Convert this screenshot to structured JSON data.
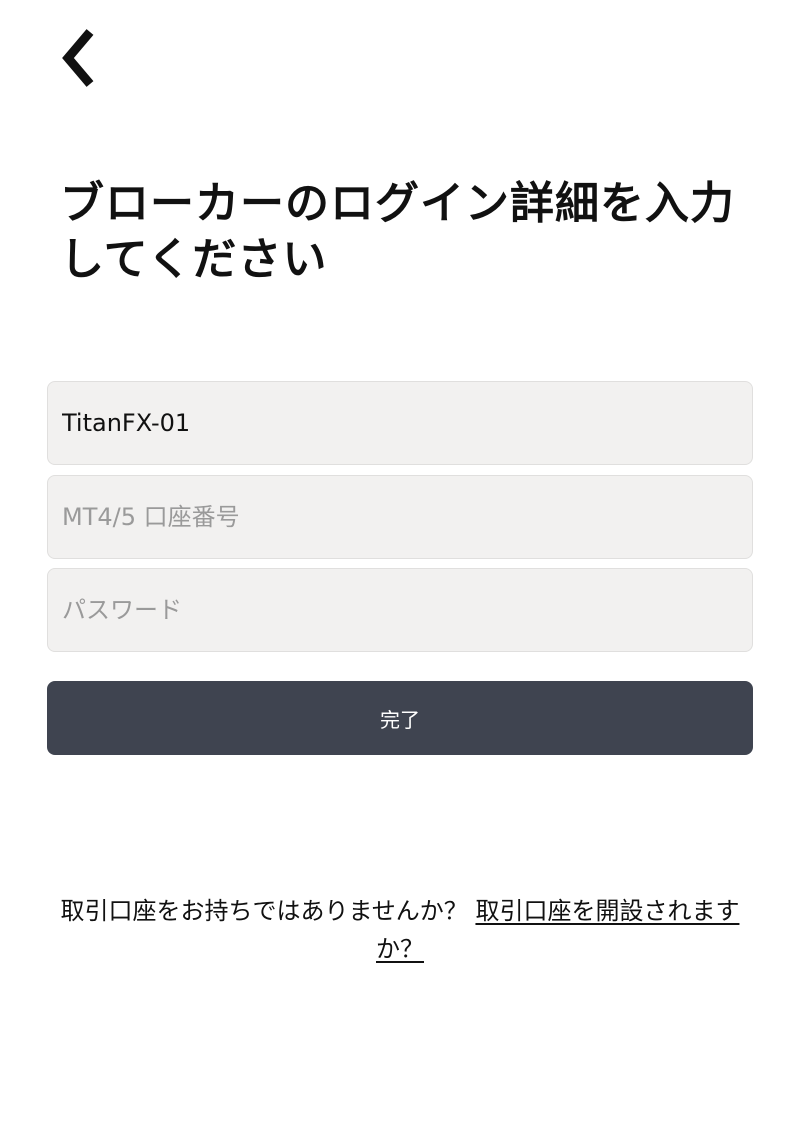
{
  "header": {
    "back_icon": "chevron-left-icon"
  },
  "title": {
    "line1": "ブローカーのログイン詳細を入力",
    "line2": "してください"
  },
  "form": {
    "server_value": "TitanFX-01",
    "account_placeholder": "MT4/5 口座番号",
    "password_placeholder": "パスワード",
    "submit_label": "完了"
  },
  "footer": {
    "prompt": "取引口座をお持ちではありませんか？",
    "link_text": "取引口座を開設されますか？"
  },
  "colors": {
    "button_bg": "#3f4450",
    "field_bg": "#f2f1f0",
    "placeholder": "#9a9a9a"
  }
}
